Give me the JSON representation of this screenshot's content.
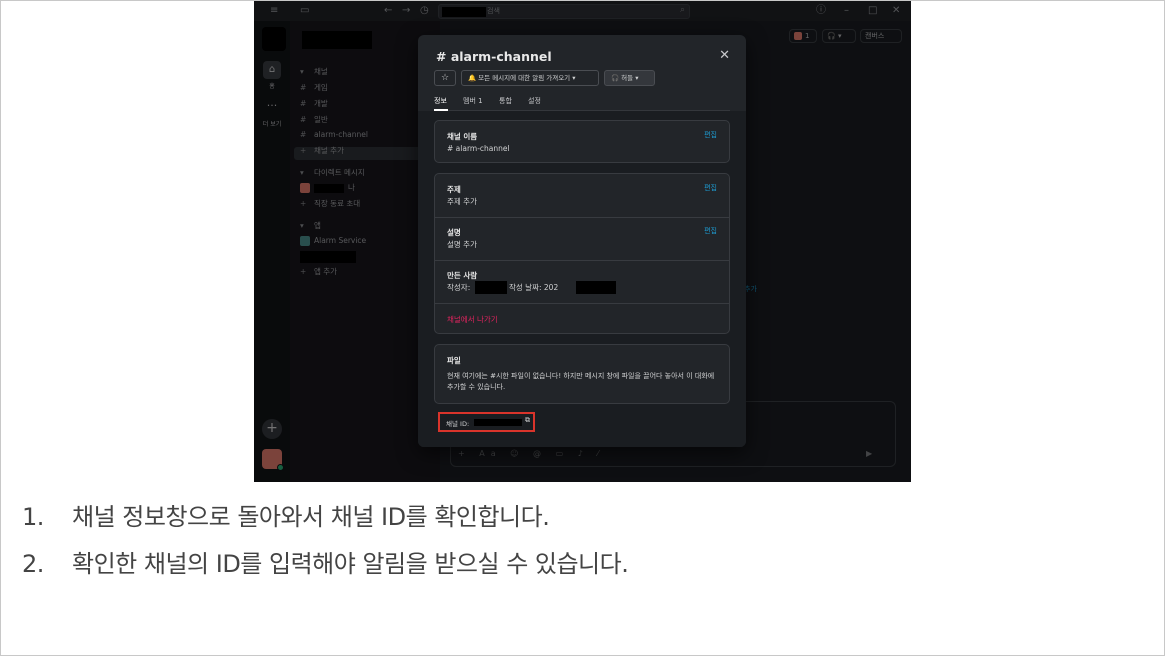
{
  "titlebar": {
    "search_text": "검색"
  },
  "rail": {
    "home_label": "홈",
    "more_label": "더 보기"
  },
  "sidebar": {
    "channels_header": "채널",
    "channels": [
      "게임",
      "개발",
      "일반",
      "alarm-channel"
    ],
    "add_channel": "채널 추가",
    "dm_header": "다이렉트 메시지",
    "dm_self_suffix": "나",
    "invite_colleagues": "직장 동료 초대",
    "apps_header": "앱",
    "app_name": "Alarm Service",
    "add_app": "앱 추가"
  },
  "header": {
    "member_count": "1",
    "canvas_label": "캔버스"
  },
  "right_link": "추가",
  "modal": {
    "title": "# alarm-channel",
    "notify_label": "모든 메시지에 대한 알림 가져오기",
    "huddle_label": "허들",
    "tabs": [
      "정보",
      "멤버 1",
      "통합",
      "설정"
    ],
    "channel_name_label": "채널 이름",
    "channel_name_value": "# alarm-channel",
    "edit_label": "편집",
    "topic_label": "주제",
    "topic_value": "주제 추가",
    "description_label": "설명",
    "description_value": "설명 추가",
    "creator_label": "만든 사람",
    "creator_by": "작성자:",
    "created_date": "작성 날짜: 202",
    "leave_label": "채널에서 나가기",
    "files_label": "파일",
    "files_text": "현재 여기에는 #시한 파일이 없습니다! 하지만 메시지 창에 파일을 끌어다 놓아서 이 대화에 추가할 수 있습니다.",
    "channel_id_label": "채널 ID:"
  },
  "instructions": [
    {
      "num": "1.",
      "text": "채널 정보창으로 돌아와서 채널 ID를 확인합니다."
    },
    {
      "num": "2.",
      "text": "확인한 채널의 ID를 입력해야 알림을 받으실 수 있습니다."
    }
  ],
  "colors": {
    "highlight_box": "#d9342b",
    "link": "#1d9bd1",
    "leave": "#e0245e"
  }
}
